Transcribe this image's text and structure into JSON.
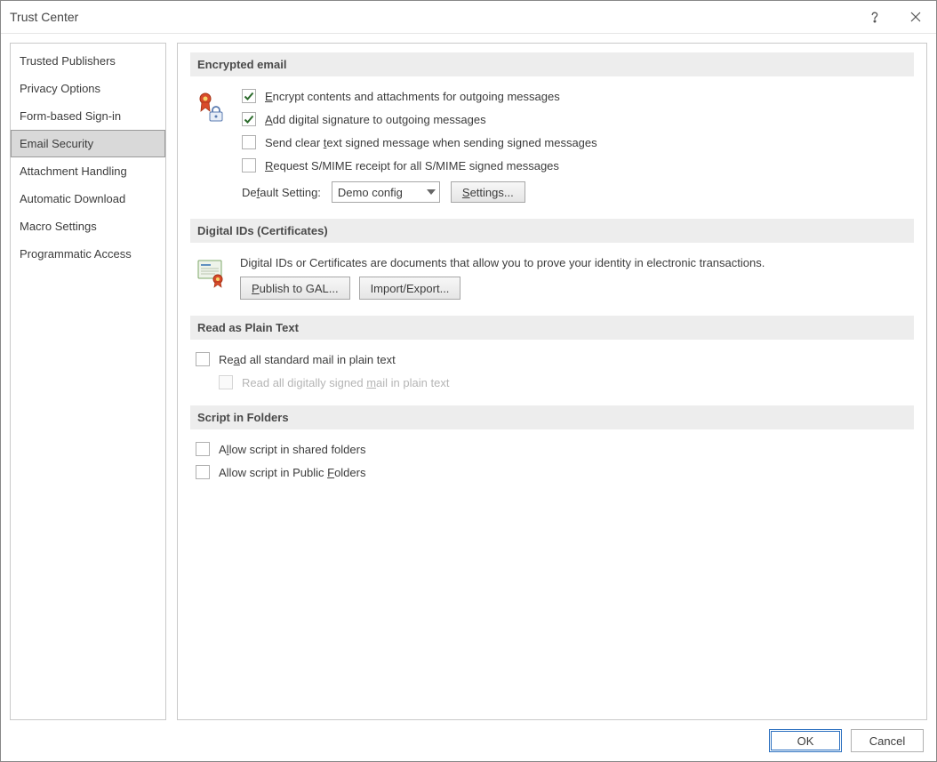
{
  "window": {
    "title": "Trust Center"
  },
  "sidebar": {
    "items": [
      {
        "label": "Trusted Publishers"
      },
      {
        "label": "Privacy Options"
      },
      {
        "label": "Form-based Sign-in"
      },
      {
        "label": "Email Security"
      },
      {
        "label": "Attachment Handling"
      },
      {
        "label": "Automatic Download"
      },
      {
        "label": "Macro Settings"
      },
      {
        "label": "Programmatic Access"
      }
    ],
    "selected_index": 3
  },
  "sections": {
    "encrypted": {
      "header": "Encrypted email"
    },
    "digital_ids": {
      "header": "Digital IDs (Certificates)"
    },
    "plain_text": {
      "header": "Read as Plain Text"
    },
    "script": {
      "header": "Script in Folders"
    }
  },
  "encrypted": {
    "options": [
      {
        "label_pre": "",
        "u": "E",
        "label_post": "ncrypt contents and attachments for outgoing messages",
        "checked": true
      },
      {
        "label_pre": "",
        "u": "A",
        "label_post": "dd digital signature to outgoing messages",
        "checked": true
      },
      {
        "label_pre": "Send clear ",
        "u": "t",
        "label_post": "ext signed message when sending signed messages",
        "checked": false
      },
      {
        "label_pre": "",
        "u": "R",
        "label_post": "equest S/MIME receipt for all S/MIME signed messages",
        "checked": false
      }
    ],
    "default_label_pre": "De",
    "default_label_u": "f",
    "default_label_post": "ault Setting:",
    "default_value": "Demo config",
    "settings_btn_u": "S",
    "settings_btn_post": "ettings..."
  },
  "digital_ids": {
    "description": "Digital IDs or Certificates are documents that allow you to prove your identity in electronic transactions.",
    "publish_btn_u": "P",
    "publish_btn_post": "ublish to GAL...",
    "import_btn": "Import/Export..."
  },
  "plain_text": {
    "opt1_pre": "Re",
    "opt1_u": "a",
    "opt1_post": "d all standard mail in plain text",
    "opt2_pre": "Read all digitally signed ",
    "opt2_u": "m",
    "opt2_post": "ail in plain text"
  },
  "script": {
    "opt1_pre": "A",
    "opt1_u": "l",
    "opt1_post": "low script in shared folders",
    "opt2_pre": "Allow script in Public ",
    "opt2_u": "F",
    "opt2_post": "olders"
  },
  "footer": {
    "ok": "OK",
    "cancel": "Cancel"
  }
}
